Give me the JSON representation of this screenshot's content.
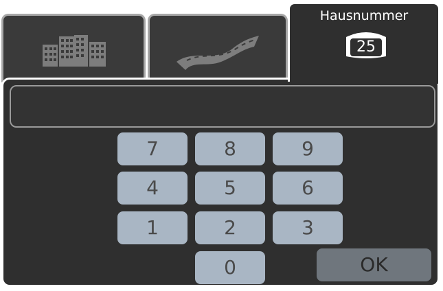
{
  "tabs": {
    "city_icon": "buildings-icon",
    "street_icon": "road-icon",
    "house": {
      "title": "Hausnummer",
      "value": "25",
      "icon": "house-number-badge-icon"
    }
  },
  "input": {
    "value": ""
  },
  "keypad": {
    "keys": [
      "7",
      "8",
      "9",
      "4",
      "5",
      "6",
      "1",
      "2",
      "3",
      "0"
    ],
    "ok_label": "OK"
  },
  "colors": {
    "panel": "#2f2f2f",
    "key": "#a9b6c4",
    "ok_key": "#6f767d",
    "tab_border_active": "#ffffff",
    "tab_border_inactive": "#a8a8a8"
  }
}
